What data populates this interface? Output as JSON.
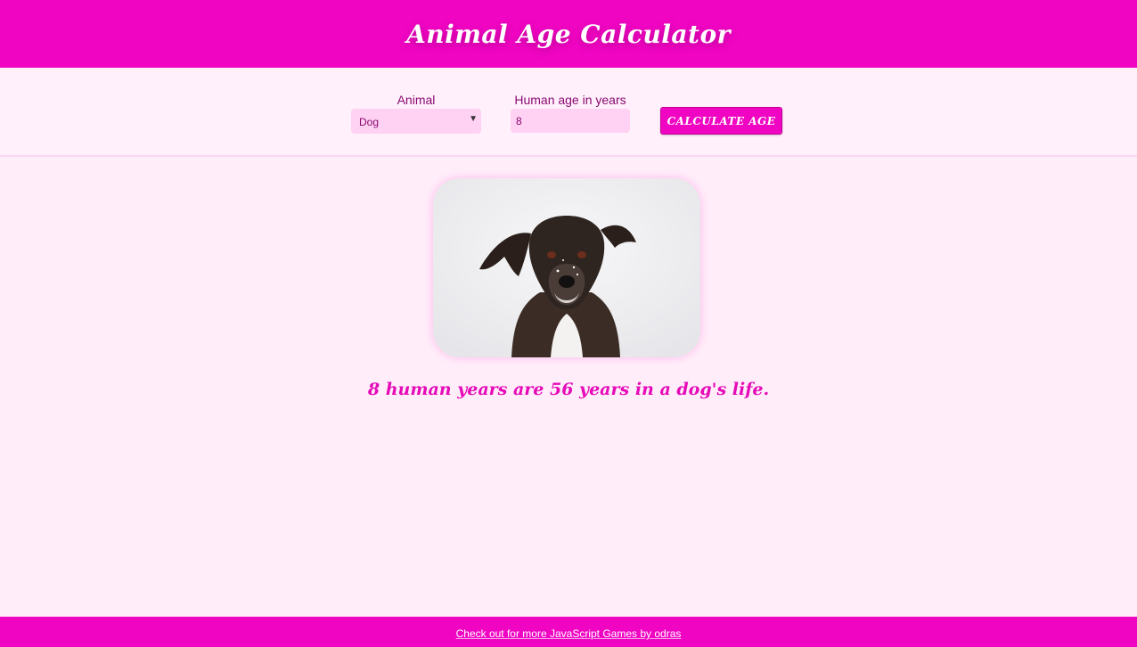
{
  "header": {
    "title": "Animal Age Calculator"
  },
  "form": {
    "animal_label": "Animal",
    "animal_selected": "Dog",
    "age_label": "Human age in years",
    "age_value": "8",
    "calculate_label": "CALCULATE AGE"
  },
  "result": {
    "text": "8 human years are 56 years in a dog's life."
  },
  "footer": {
    "link_text": "Check out for more JavaScript Games by odras"
  },
  "colors": {
    "brand": "#f005c2",
    "background": "#ffeefa",
    "input_background": "#ffd1f3",
    "result_text": "#e60ab8"
  },
  "icons": {
    "select_arrow": "dropdown-arrow-icon"
  }
}
